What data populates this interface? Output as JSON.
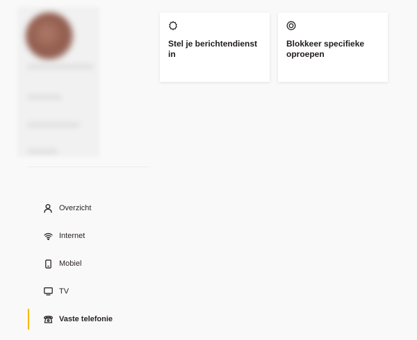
{
  "sidebar": {
    "nav_items": [
      {
        "label": "Overzicht",
        "icon": "user-icon"
      },
      {
        "label": "Internet",
        "icon": "wifi-icon"
      },
      {
        "label": "Mobiel",
        "icon": "mobile-icon"
      },
      {
        "label": "TV",
        "icon": "tv-icon"
      },
      {
        "label": "Vaste telefonie",
        "icon": "landline-phone-icon",
        "active": true
      }
    ]
  },
  "cards": [
    {
      "title": "Stel je berichtendienst in",
      "icon": "settings-icon"
    },
    {
      "title": "Blokkeer specifieke oproepen",
      "icon": "block-icon"
    }
  ],
  "colors": {
    "accent": "#f5b800",
    "background": "#f9f9f9",
    "card": "#ffffff",
    "text": "#1f1a1a"
  }
}
